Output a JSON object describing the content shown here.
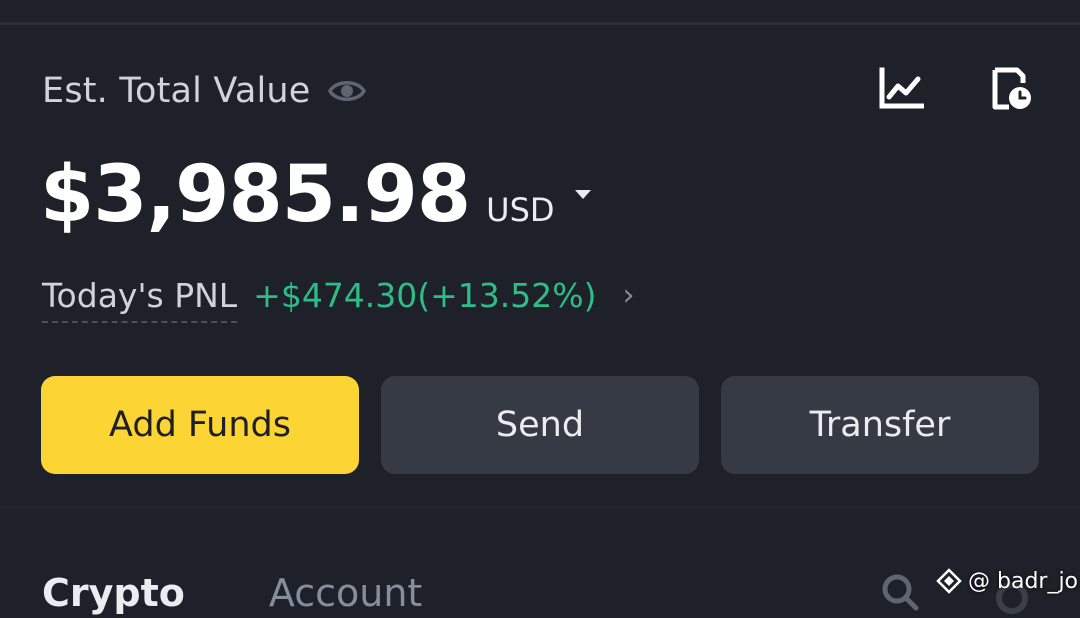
{
  "header": {
    "est_total_value_label": "Est. Total Value"
  },
  "balance": {
    "amount": "$3,985.98",
    "currency": "USD"
  },
  "pnl": {
    "label": "Today's PNL",
    "value": "+$474.30(+13.52%)",
    "color": "#2ebd85"
  },
  "actions": {
    "add_funds": "Add Funds",
    "send": "Send",
    "transfer": "Transfer",
    "primary_color": "#fcd535"
  },
  "tabs": {
    "crypto": "Crypto",
    "account": "Account"
  },
  "icons": {
    "eye": "eye-icon",
    "chart": "chart-icon",
    "history": "history-icon",
    "search": "search-icon",
    "settings": "settings-icon"
  },
  "watermark": {
    "text": "@ badr_jo"
  }
}
